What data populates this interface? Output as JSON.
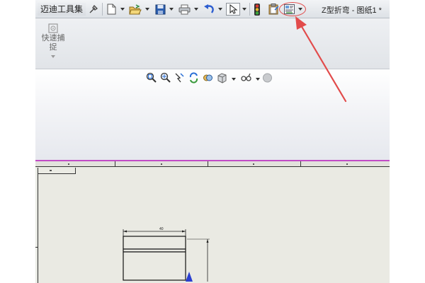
{
  "toolbar": {
    "brand_label": "迈迪工具集",
    "document_title": "Z型折弯 - 图纸1 *"
  },
  "ribbon": {
    "quick_snap_label": "快速捕捉"
  },
  "colors": {
    "annotation_red": "#e24b4b",
    "sheet_border_magenta": "#c24cc6",
    "sheet_background": "#eaeae3"
  },
  "icons": {
    "quick_access": [
      "pin-icon",
      "new-document-icon",
      "open-folder-icon",
      "save-icon",
      "print-icon",
      "undo-icon",
      "select-cursor-icon",
      "traffic-light-icon",
      "clipboard-icon",
      "drawing-options-icon"
    ],
    "view_toolbar": [
      "zoom-to-fit-icon",
      "zoom-area-icon",
      "previous-view-icon",
      "rebuild-icon",
      "pan-icon",
      "display-style-icon",
      "view-settings-icon",
      "appearance-icon"
    ]
  },
  "drawing": {
    "dimension_label": "40"
  }
}
